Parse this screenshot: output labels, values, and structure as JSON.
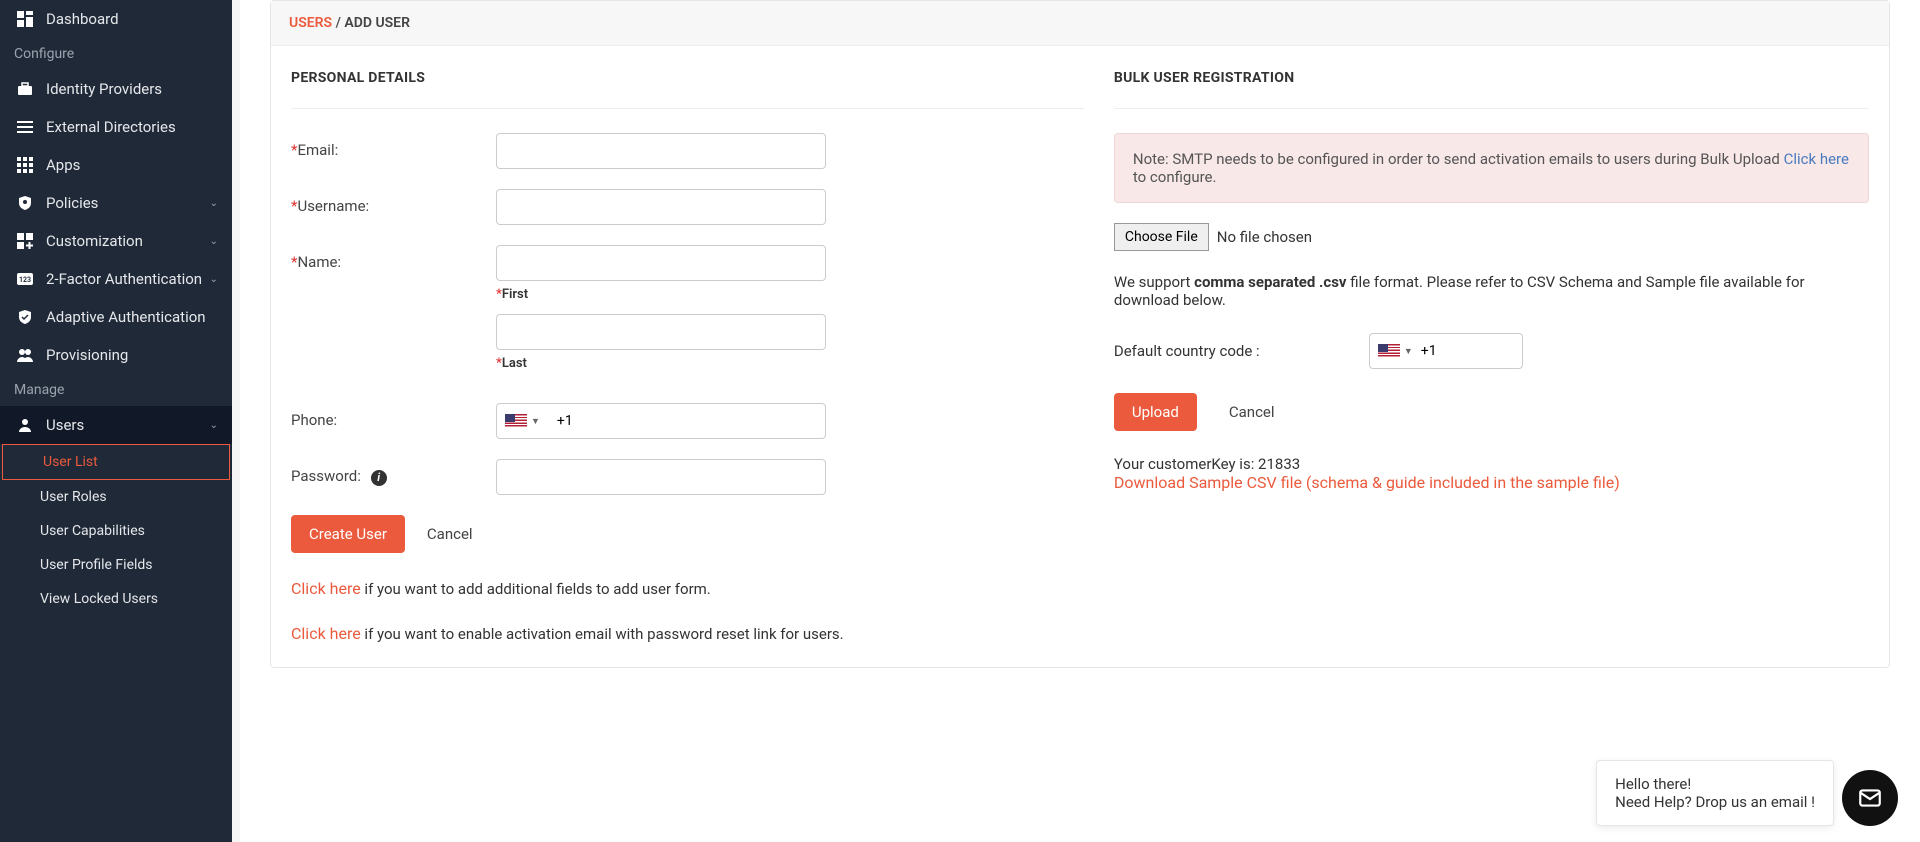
{
  "sidebar": {
    "items": [
      {
        "label": "Dashboard"
      },
      {
        "section": "Configure"
      },
      {
        "label": "Identity Providers"
      },
      {
        "label": "External Directories"
      },
      {
        "label": "Apps"
      },
      {
        "label": "Policies",
        "expandable": true
      },
      {
        "label": "Customization",
        "expandable": true
      },
      {
        "label": "2-Factor Authentication",
        "expandable": true
      },
      {
        "label": "Adaptive Authentication"
      },
      {
        "label": "Provisioning"
      },
      {
        "section": "Manage"
      },
      {
        "label": "Users",
        "expandable": true,
        "selected": true
      }
    ],
    "users_sub": [
      {
        "label": "User List",
        "active": true
      },
      {
        "label": "User Roles"
      },
      {
        "label": "User Capabilities"
      },
      {
        "label": "User Profile Fields"
      },
      {
        "label": "View Locked Users"
      }
    ]
  },
  "breadcrumb": {
    "a": "USERS",
    "sep": "/",
    "b": "ADD USER"
  },
  "personal": {
    "title": "PERSONAL DETAILS",
    "email_label": "Email:",
    "username_label": "Username:",
    "name_label": "Name:",
    "first_label": "First",
    "last_label": "Last",
    "phone_label": "Phone:",
    "phone_value": "+1",
    "password_label": "Password:",
    "create_btn": "Create User",
    "cancel_btn": "Cancel",
    "add_fields_link": "Click here",
    "add_fields_rest": " if you want to add additional fields to add user form.",
    "activation_link": "Click here",
    "activation_rest": " if you want to enable activation email with password reset link for users."
  },
  "bulk": {
    "title": "BULK USER REGISTRATION",
    "alert_a": "Note: SMTP needs to be configured in order to send activation emails to users during Bulk Upload ",
    "alert_link": "Click here",
    "alert_b": " to configure.",
    "choose_file": "Choose File",
    "no_file": "No file chosen",
    "support_a": "We support ",
    "support_b": "comma separated .csv",
    "support_c": " file format. Please refer to CSV Schema and Sample file available for download below.",
    "cc_label": "Default country code :",
    "cc_value": "+1",
    "upload_btn": "Upload",
    "cancel_btn": "Cancel",
    "key_label": "Your customerKey is: ",
    "key_value": "21833",
    "download_link": "Download Sample CSV file (schema & guide included in the sample file)"
  },
  "chat": {
    "line1": "Hello there!",
    "line2": "Need Help? Drop us an email !"
  }
}
